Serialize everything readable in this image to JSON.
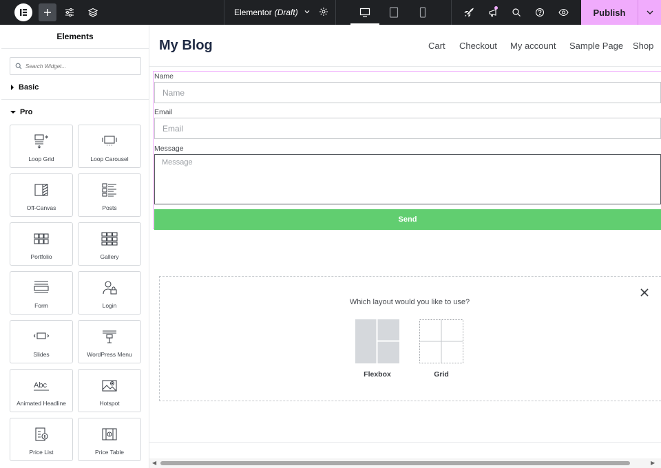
{
  "topbar": {
    "document_name": "Elementor",
    "document_status": "(Draft)",
    "publish_label": "Publish"
  },
  "panel": {
    "title": "Elements",
    "search_placeholder": "Search Widget...",
    "categories": [
      {
        "label": "Basic",
        "expanded": false
      },
      {
        "label": "Pro",
        "expanded": true
      }
    ],
    "widgets": [
      {
        "label": "Loop Grid",
        "icon": "loop-grid-icon"
      },
      {
        "label": "Loop Carousel",
        "icon": "loop-carousel-icon"
      },
      {
        "label": "Off-Canvas",
        "icon": "off-canvas-icon"
      },
      {
        "label": "Posts",
        "icon": "posts-icon"
      },
      {
        "label": "Portfolio",
        "icon": "portfolio-icon"
      },
      {
        "label": "Gallery",
        "icon": "gallery-icon"
      },
      {
        "label": "Form",
        "icon": "form-icon"
      },
      {
        "label": "Login",
        "icon": "login-icon"
      },
      {
        "label": "Slides",
        "icon": "slides-icon"
      },
      {
        "label": "WordPress Menu",
        "icon": "wordpress-menu-icon"
      },
      {
        "label": "Animated Headline",
        "icon": "animated-headline-icon"
      },
      {
        "label": "Hotspot",
        "icon": "hotspot-icon"
      },
      {
        "label": "Price List",
        "icon": "price-list-icon"
      },
      {
        "label": "Price Table",
        "icon": "price-table-icon"
      }
    ]
  },
  "site": {
    "title": "My Blog",
    "nav": [
      "Cart",
      "Checkout",
      "My account",
      "Sample Page",
      "Shop"
    ]
  },
  "form": {
    "name_label": "Name",
    "name_placeholder": "Name",
    "email_label": "Email",
    "email_placeholder": "Email",
    "message_label": "Message",
    "message_placeholder": "Message",
    "send_label": "Send"
  },
  "layout_picker": {
    "question": "Which layout would you like to use?",
    "options": [
      "Flexbox",
      "Grid"
    ]
  },
  "colors": {
    "accent": "#f0abfc",
    "topbar": "#1f2124",
    "send_button": "#61ce70"
  }
}
